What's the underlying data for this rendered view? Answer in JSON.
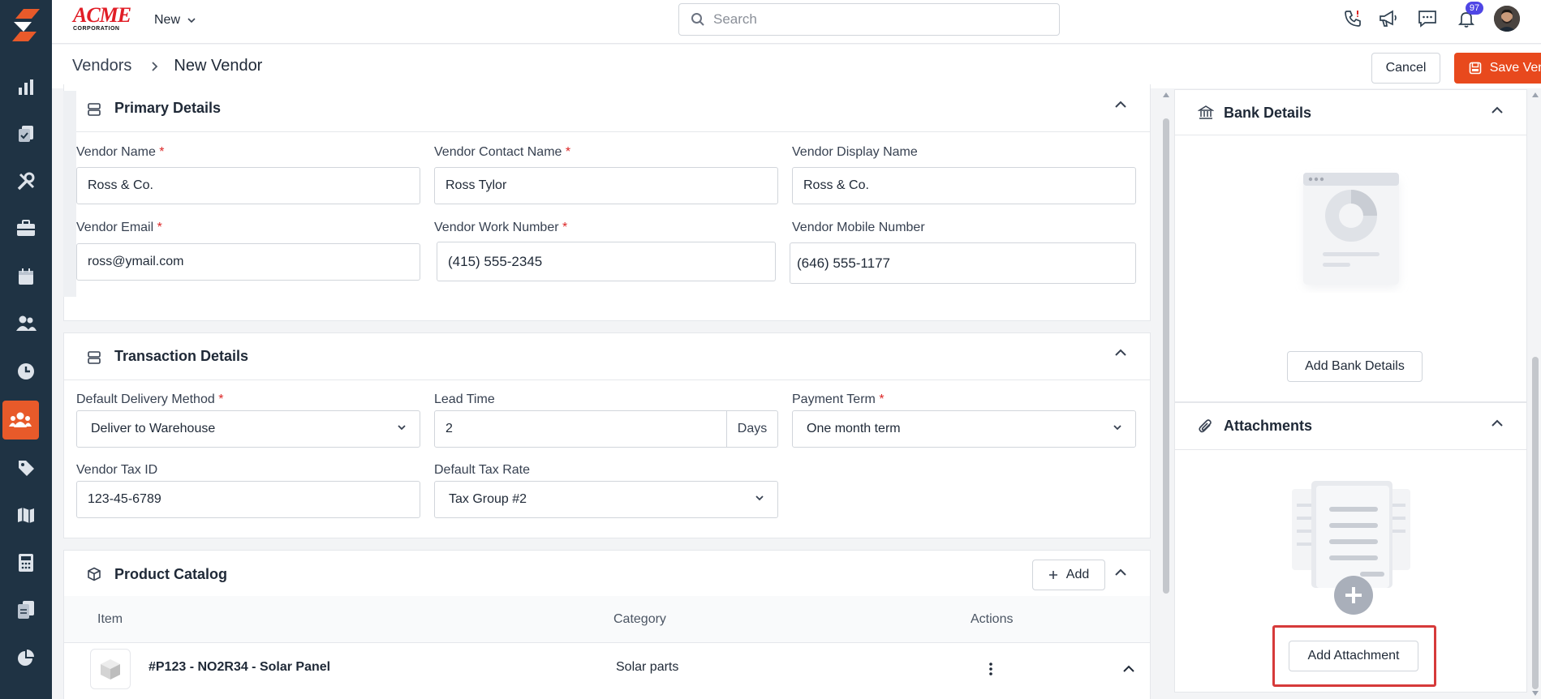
{
  "rail": {
    "items": [
      {
        "icon": "bar-chart-icon"
      },
      {
        "icon": "documents-check-icon"
      },
      {
        "icon": "tools-icon"
      },
      {
        "icon": "briefcase-icon"
      },
      {
        "icon": "calendar-icon"
      },
      {
        "icon": "users-icon"
      },
      {
        "icon": "clock-icon"
      },
      {
        "icon": "vendors-icon",
        "active": true
      },
      {
        "icon": "tag-icon"
      },
      {
        "icon": "map-icon"
      },
      {
        "icon": "calculator-icon"
      },
      {
        "icon": "files-icon"
      },
      {
        "icon": "pie-chart-icon"
      }
    ],
    "accent": "#e85a2a",
    "bg": "#1f3344"
  },
  "topbar": {
    "brand_line1": "ACME",
    "brand_line2": "CORPORATION",
    "new_label": "New",
    "search_placeholder": "Search",
    "notification_count": "97"
  },
  "breadcrumb": {
    "parent": "Vendors",
    "current": "New Vendor"
  },
  "actions": {
    "cancel_label": "Cancel",
    "save_label": "Save Vendor",
    "save_color": "#e8491d"
  },
  "primary": {
    "title": "Primary Details",
    "fields": {
      "vendor_name": {
        "label": "Vendor Name",
        "value": "Ross & Co."
      },
      "contact_name": {
        "label": "Vendor Contact Name",
        "value": "Ross Tylor"
      },
      "display_name": {
        "label": "Vendor Display Name",
        "value": "Ross & Co."
      },
      "email": {
        "label": "Vendor Email",
        "value": "ross@ymail.com"
      },
      "work_number": {
        "label": "Vendor Work Number",
        "value": "(415) 555-2345"
      },
      "mobile_number": {
        "label": "Vendor Mobile Number",
        "value": "(646) 555-1177"
      }
    }
  },
  "transaction": {
    "title": "Transaction Details",
    "fields": {
      "delivery_method": {
        "label": "Default Delivery Method",
        "value": "Deliver to Warehouse"
      },
      "lead_time": {
        "label": "Lead Time",
        "value": "2",
        "unit": "Days"
      },
      "payment_term": {
        "label": "Payment Term",
        "value": "One month term"
      },
      "tax_id": {
        "label": "Vendor Tax ID",
        "value": "123-45-6789"
      },
      "tax_rate": {
        "label": "Default Tax Rate",
        "value": "Tax Group #2"
      }
    }
  },
  "catalog": {
    "title": "Product Catalog",
    "add_label": "Add",
    "columns": [
      "Item",
      "Category",
      "Actions"
    ],
    "rows": [
      {
        "item": "#P123 - NO2R34 - Solar Panel",
        "category": "Solar parts"
      }
    ]
  },
  "bank": {
    "title": "Bank Details",
    "button_label": "Add Bank Details"
  },
  "attachments": {
    "title": "Attachments",
    "button_label": "Add Attachment",
    "highlight_color": "#d63a3a"
  }
}
